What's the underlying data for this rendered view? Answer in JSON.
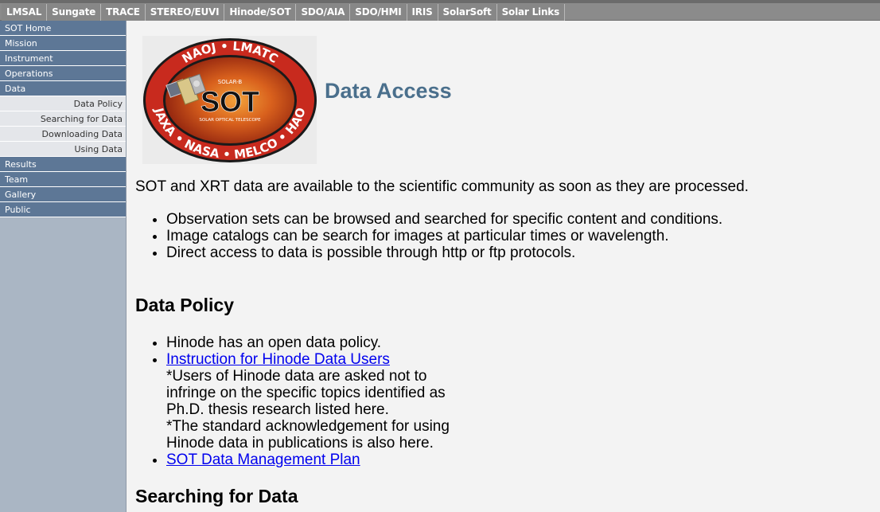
{
  "topnav": [
    "LMSAL",
    "Sungate",
    "TRACE",
    "STEREO/EUVI",
    "Hinode/SOT",
    "SDO/AIA",
    "SDO/HMI",
    "IRIS",
    "SolarSoft",
    "Solar Links"
  ],
  "sidebar": {
    "items": [
      {
        "label": "SOT Home",
        "sub": false
      },
      {
        "label": "Mission",
        "sub": false
      },
      {
        "label": "Instrument",
        "sub": false
      },
      {
        "label": "Operations",
        "sub": false
      },
      {
        "label": "Data",
        "sub": false
      },
      {
        "label": "Data Policy",
        "sub": true
      },
      {
        "label": "Searching for Data",
        "sub": true
      },
      {
        "label": "Downloading Data",
        "sub": true
      },
      {
        "label": "Using Data",
        "sub": true
      },
      {
        "label": "Results",
        "sub": false
      },
      {
        "label": "Team",
        "sub": false
      },
      {
        "label": "Gallery",
        "sub": false
      },
      {
        "label": "Public",
        "sub": false
      }
    ]
  },
  "logo": {
    "top_text": "NAOJ • LMATC",
    "bottom_text": "JAXA • NASA • MELCO • HAO",
    "mission": "SOLAR-B",
    "name": "SOT",
    "subtitle": "SOLAR OPTICAL TELESCOPE"
  },
  "main": {
    "title": "Data Access",
    "intro": "SOT and XRT data are available to the scientific community as soon as they are processed.",
    "intro_bullets": [
      "Observation sets can be browsed and searched for specific content and conditions.",
      "Image catalogs can be search for images at particular times or wavelength.",
      "Direct access to data is possible through http or ftp protocols."
    ],
    "policy": {
      "heading": "Data Policy",
      "bullet1": "Hinode has an open data policy.",
      "link1": "Instruction for Hinode Data Users",
      "note1_l1": "*Users of Hinode data are asked not to",
      "note1_l2": "infringe on the specific topics identified as",
      "note1_l3": "Ph.D. thesis research listed here.",
      "note2_l1": "*The standard acknowledgement for using",
      "note2_l2": "Hinode data in publications is also here.",
      "link2": "SOT Data Management Plan"
    },
    "search_heading": "Searching for Data"
  },
  "colors": {
    "accent_title": "#4a6f8c",
    "sidebar_item": "#5d7796",
    "sidebar_sub": "#e4e6ea",
    "topbar": "#878787",
    "link": "#0000ee"
  }
}
